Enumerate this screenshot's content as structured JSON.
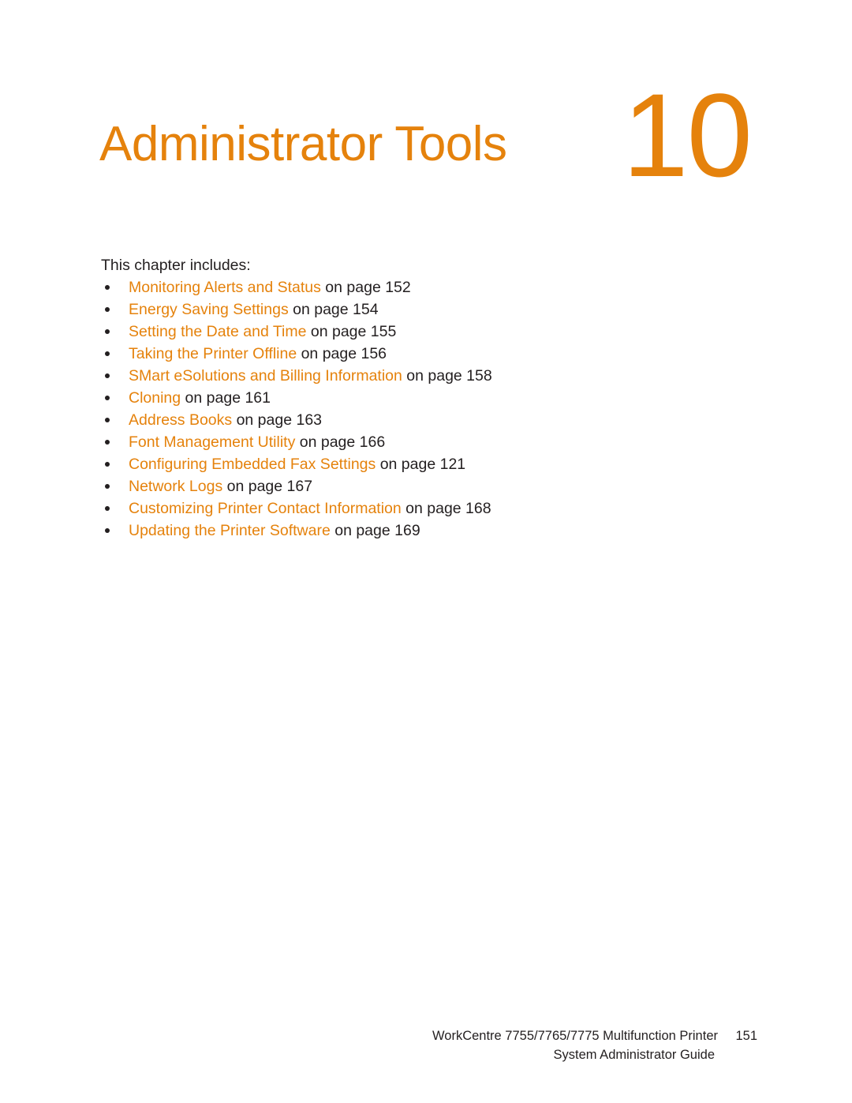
{
  "document": {
    "type": "pdf-manual-page",
    "background_color": "#ffffff",
    "accent_color": "#E5820C",
    "text_color": "#231f20"
  },
  "chapter": {
    "title": "Administrator Tools",
    "number": "10"
  },
  "body": {
    "intro": "This chapter includes:",
    "list_items": [
      {
        "link": "Monitoring Alerts and Status",
        "tail": " on page 152"
      },
      {
        "link": "Energy Saving Settings",
        "tail": " on page 154"
      },
      {
        "link": "Setting the Date and Time",
        "tail": " on page 155"
      },
      {
        "link": "Taking the Printer Offline",
        "tail": " on page 156"
      },
      {
        "link": "SMart eSolutions and Billing Information",
        "tail": " on page 158"
      },
      {
        "link": "Cloning",
        "tail": " on page 161"
      },
      {
        "link": "Address Books",
        "tail": " on page 163"
      },
      {
        "link": "Font Management Utility",
        "tail": " on page 166"
      },
      {
        "link": "Configuring Embedded Fax Settings",
        "tail": " on page 121"
      },
      {
        "link": "Network Logs",
        "tail": " on page 167"
      },
      {
        "link": "Customizing Printer Contact Information",
        "tail": " on page 168"
      },
      {
        "link": "Updating the Printer Software",
        "tail": " on page 169"
      }
    ]
  },
  "footer": {
    "product": "WorkCentre 7755/7765/7775 Multifunction Printer",
    "page_number": "151",
    "guide": "System Administrator Guide"
  }
}
